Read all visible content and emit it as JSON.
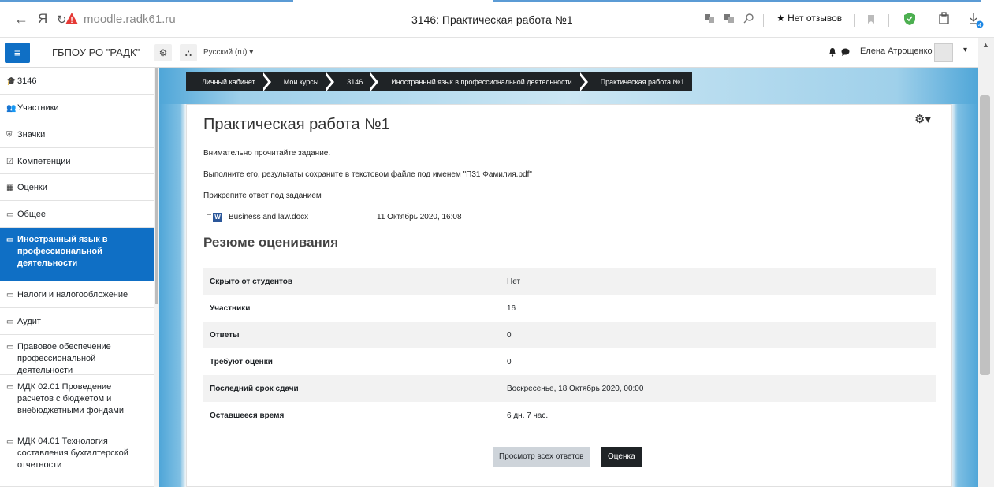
{
  "browser": {
    "back": "←",
    "yandex_logo": "Я",
    "reload": "↻",
    "url": "moodle.radk61.ru",
    "tab_title": "3146: Практическая работа №1",
    "reviews": "★ Нет отзывов"
  },
  "navbar": {
    "menu_icon": "≡",
    "site_name": "ГБПОУ РО \"РАДК\"",
    "language": "Русский (ru) ▾",
    "user_name": "Елена Атрощенко",
    "user_menu_caret": "▾"
  },
  "sidebar": {
    "items": [
      {
        "label": "3146",
        "icon": "graduation-cap-icon",
        "glyph": "🎓"
      },
      {
        "label": "Участники",
        "icon": "users-icon",
        "glyph": "👥"
      },
      {
        "label": "Значки",
        "icon": "shield-icon",
        "glyph": "⛨"
      },
      {
        "label": "Компетенции",
        "icon": "checkbox-icon",
        "glyph": "☑"
      },
      {
        "label": "Оценки",
        "icon": "table-icon",
        "glyph": "▦"
      },
      {
        "label": "Общее",
        "icon": "folder-icon",
        "glyph": "▭"
      },
      {
        "label": "Иностранный язык в профессиональной деятельности",
        "icon": "folder-icon",
        "glyph": "▭",
        "active": true
      },
      {
        "label": "Налоги и налогообложение",
        "icon": "folder-icon",
        "glyph": "▭"
      },
      {
        "label": "Аудит",
        "icon": "folder-icon",
        "glyph": "▭"
      },
      {
        "label": "Правовое обеспечение профессиональной деятельности",
        "icon": "folder-icon",
        "glyph": "▭"
      },
      {
        "label": "МДК 02.01 Проведение расчетов с бюджетом и внебюджетными фондами",
        "icon": "folder-icon",
        "glyph": "▭"
      },
      {
        "label": "МДК 04.01 Технология составления бухгалтерской отчетности",
        "icon": "folder-icon",
        "glyph": "▭"
      }
    ]
  },
  "breadcrumb": [
    "Личный кабинет",
    "Мои курсы",
    "3146",
    "Иностранный язык в профессиональной деятельности",
    "Практическая работа №1"
  ],
  "main": {
    "title": "Практическая работа №1",
    "intro": [
      "Внимательно прочитайте задание.",
      "Выполните его, результаты сохраните в текстовом файле под именем \"П31 Фамилия.pdf\"",
      "Прикрепите ответ под заданием"
    ],
    "file": {
      "name": "Business and law.docx",
      "date": "11 Октябрь 2020, 16:08",
      "icon_letter": "W"
    },
    "summary_title": "Резюме оценивания",
    "summary": [
      {
        "label": "Скрыто от студентов",
        "value": "Нет"
      },
      {
        "label": "Участники",
        "value": "16"
      },
      {
        "label": "Ответы",
        "value": "0"
      },
      {
        "label": "Требуют оценки",
        "value": "0"
      },
      {
        "label": "Последний срок сдачи",
        "value": "Воскресенье, 18 Октябрь 2020, 00:00"
      },
      {
        "label": "Оставшееся время",
        "value": "6 дн. 7 час."
      }
    ],
    "buttons": {
      "view_all": "Просмотр всех ответов",
      "grade": "Оценка"
    }
  }
}
